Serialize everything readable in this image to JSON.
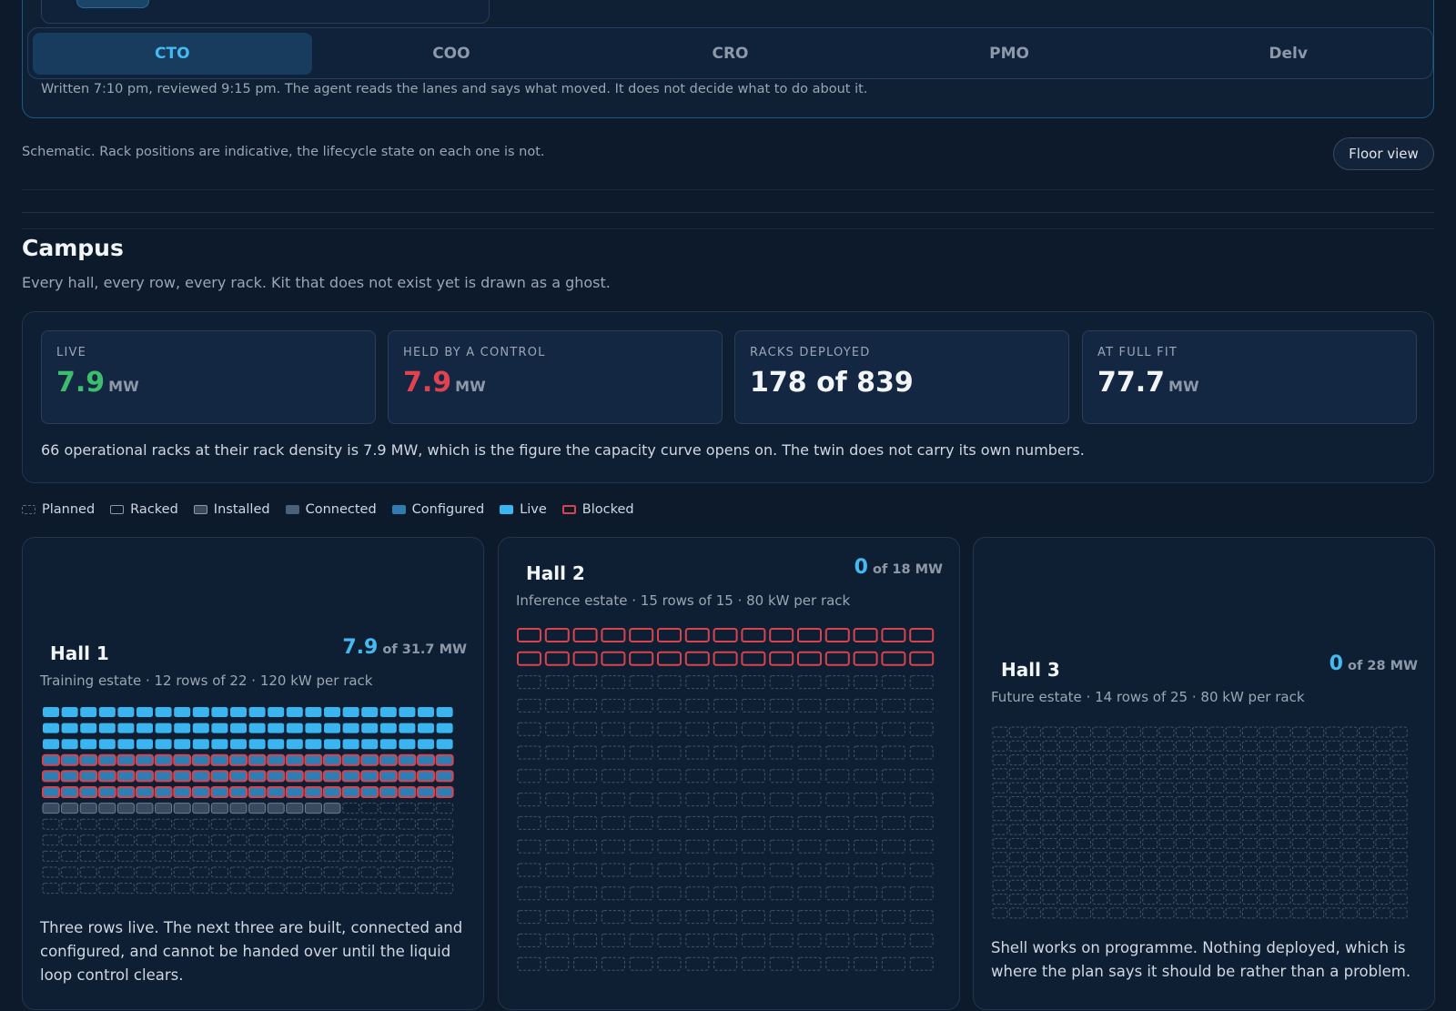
{
  "tabs": [
    {
      "label": "CTO",
      "active": true
    },
    {
      "label": "COO",
      "active": false
    },
    {
      "label": "CRO",
      "active": false
    },
    {
      "label": "PMO",
      "active": false
    },
    {
      "label": "Delv",
      "active": false
    }
  ],
  "review_note": "Written 7:10 pm, reviewed 9:15 pm. The agent reads the lanes and says what moved. It does not decide what to do about it.",
  "schematic_note": "Schematic. Rack positions are indicative, the lifecycle state on each one is not.",
  "floor_view_label": "Floor view",
  "campus": {
    "title": "Campus",
    "subtitle": "Every hall, every row, every rack. Kit that does not exist yet is drawn as a ghost."
  },
  "stats": [
    {
      "label": "LIVE",
      "value": "7.9",
      "unit": "MW",
      "color": "#3ebd6e"
    },
    {
      "label": "HELD BY A CONTROL",
      "value": "7.9",
      "unit": "MW",
      "color": "#e0434f"
    },
    {
      "label": "RACKS DEPLOYED",
      "value": "178 of 839",
      "unit": "",
      "color": "#f2f5f8"
    },
    {
      "label": "AT FULL FIT",
      "value": "77.7",
      "unit": "MW",
      "color": "#f2f5f8"
    }
  ],
  "stats_description": "66 operational racks at their rack density is 7.9 MW, which is the figure the capacity curve opens on. The twin does not carry its own numbers.",
  "legend": [
    "Planned",
    "Racked",
    "Installed",
    "Connected",
    "Configured",
    "Live",
    "Blocked"
  ],
  "colors": {
    "live": "#3ab5ef",
    "blocked": "#d8434e",
    "installed": "#3a4a5e",
    "planned": "#44546a",
    "accent": "#45b9f0"
  },
  "halls": [
    {
      "name": "Hall 1",
      "mw": "7.9",
      "of": "of 31.7 MW",
      "subtitle": "Training estate · 12 rows of 22 · 120 kW per rack",
      "description": "Three rows live. The next three are built, connected and configured, and cannot be handed over until the liquid loop control clears.",
      "rows": 12,
      "cols": 22,
      "state_rows": [
        "live",
        "live",
        "live",
        "blocked-live",
        "blocked-live",
        "blocked-live",
        "installed:16",
        "planned",
        "planned",
        "planned",
        "planned",
        "planned"
      ]
    },
    {
      "name": "Hall 2",
      "mw": "0",
      "of": "of 18 MW",
      "subtitle": "Inference estate · 15 rows of 15 · 80 kW per rack",
      "description": "",
      "rows": 15,
      "cols": 15,
      "state_rows": [
        "blocked",
        "blocked",
        "planned",
        "planned",
        "planned",
        "planned",
        "planned",
        "planned",
        "planned",
        "planned",
        "planned",
        "planned",
        "planned",
        "planned",
        "planned"
      ]
    },
    {
      "name": "Hall 3",
      "mw": "0",
      "of": "of 28 MW",
      "subtitle": "Future estate · 14 rows of 25 · 80 kW per rack",
      "description": "Shell works on programme. Nothing deployed, which is where the plan says it should be rather than a problem.",
      "rows": 14,
      "cols": 25,
      "state_rows": [
        "planned",
        "planned",
        "planned",
        "planned",
        "planned",
        "planned",
        "planned",
        "planned",
        "planned",
        "planned",
        "planned",
        "planned",
        "planned",
        "planned"
      ]
    }
  ]
}
